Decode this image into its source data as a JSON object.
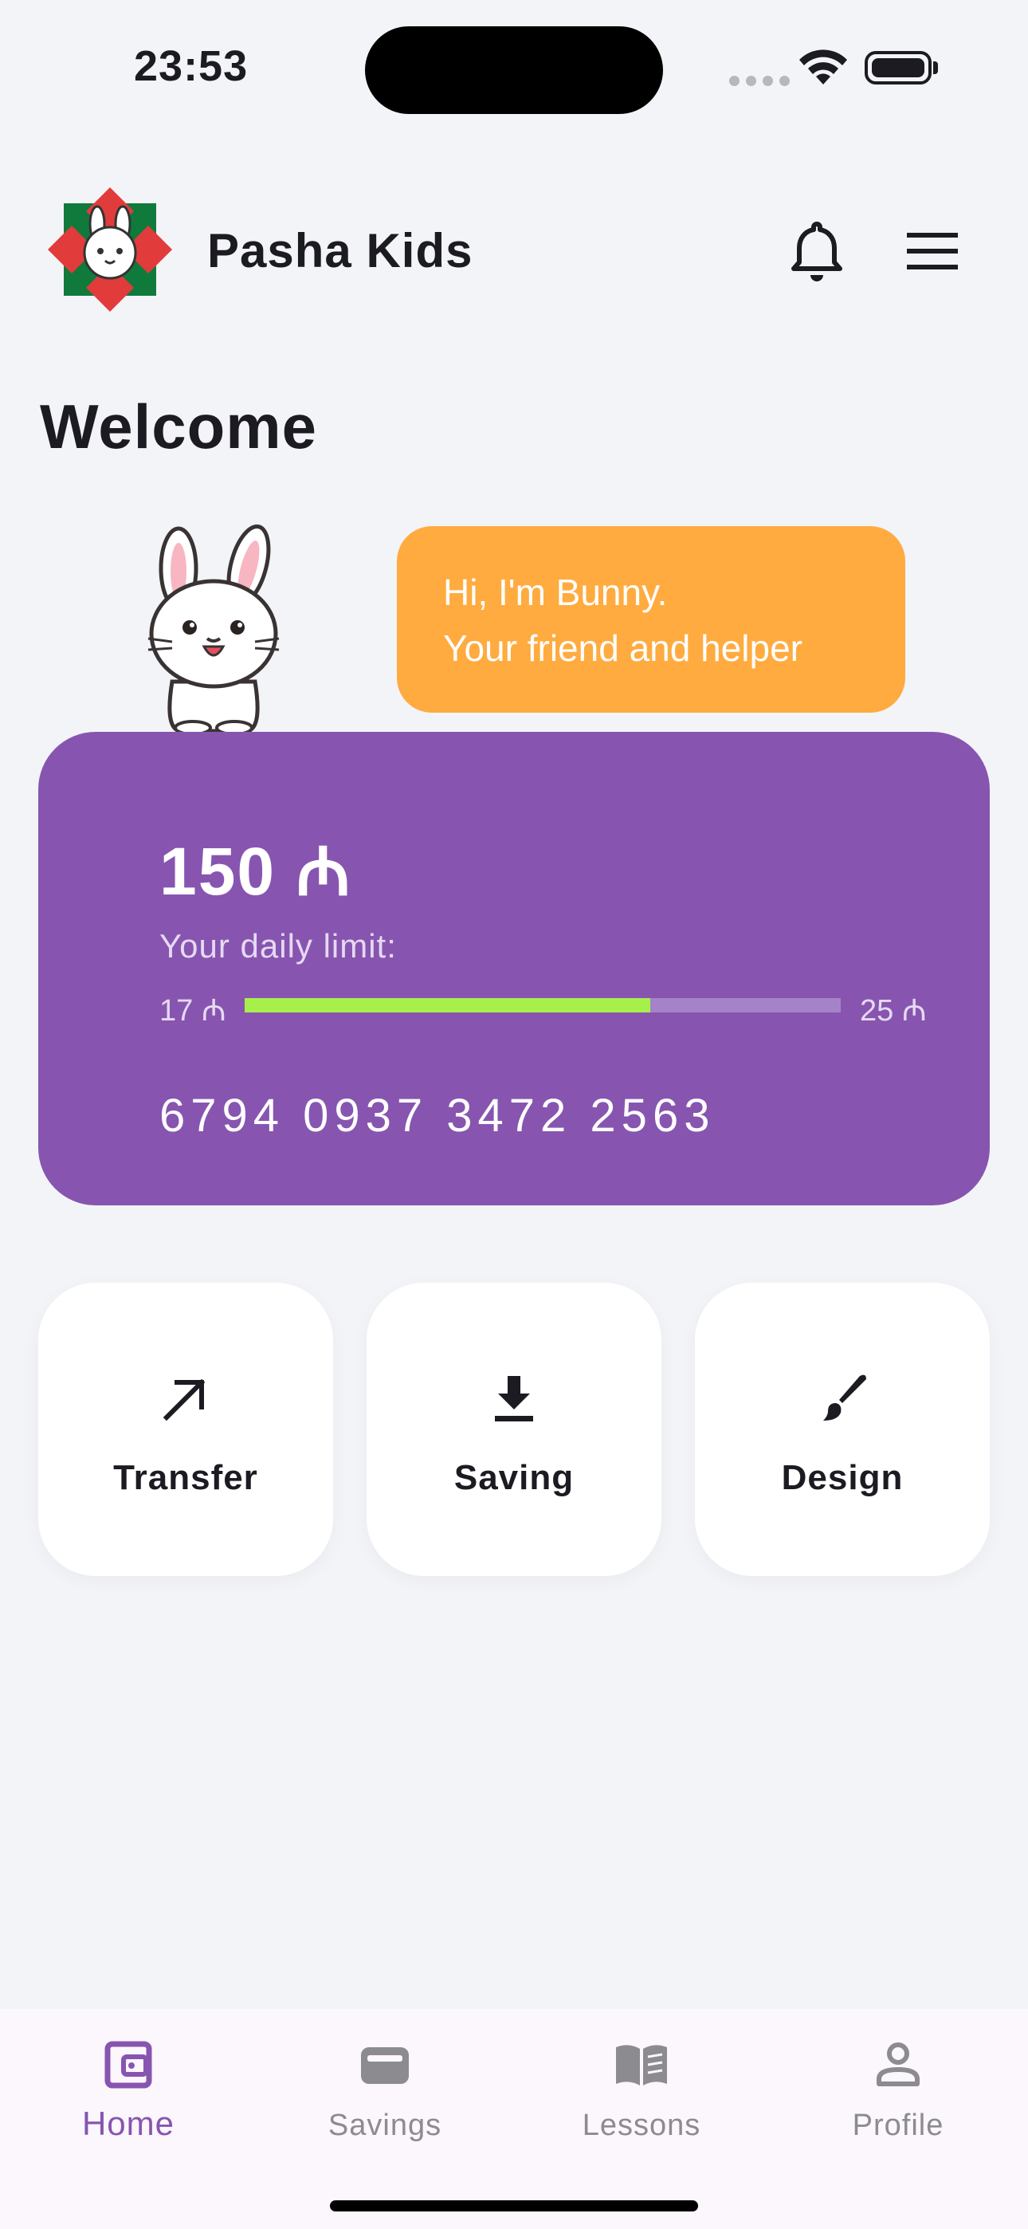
{
  "status_bar": {
    "time": "23:53"
  },
  "header": {
    "app_name": "Pasha Kids"
  },
  "page": {
    "title": "Welcome"
  },
  "mascot": {
    "line1": "Hi, I'm Bunny.",
    "line2": "Your friend and helper"
  },
  "card": {
    "balance": "150 ₼",
    "limit_label": "Your daily limit:",
    "limit_min": "17 ₼",
    "limit_max": "25 ₼",
    "limit_progress": 0.68,
    "number": "6794 0937 3472 2563"
  },
  "actions": [
    {
      "label": "Transfer",
      "icon": "arrow-up-right-icon"
    },
    {
      "label": "Saving",
      "icon": "download-icon"
    },
    {
      "label": "Design",
      "icon": "brush-icon"
    }
  ],
  "nav": [
    {
      "label": "Home",
      "icon": "wallet-icon",
      "active": true
    },
    {
      "label": "Savings",
      "icon": "card-icon",
      "active": false
    },
    {
      "label": "Lessons",
      "icon": "book-icon",
      "active": false
    },
    {
      "label": "Profile",
      "icon": "person-icon",
      "active": false
    }
  ],
  "colors": {
    "background": "#f3f4f8",
    "card": "#8755b0",
    "bubble": "#ffab40",
    "progress": "#a7f04c",
    "nav_active": "#8755b0"
  }
}
